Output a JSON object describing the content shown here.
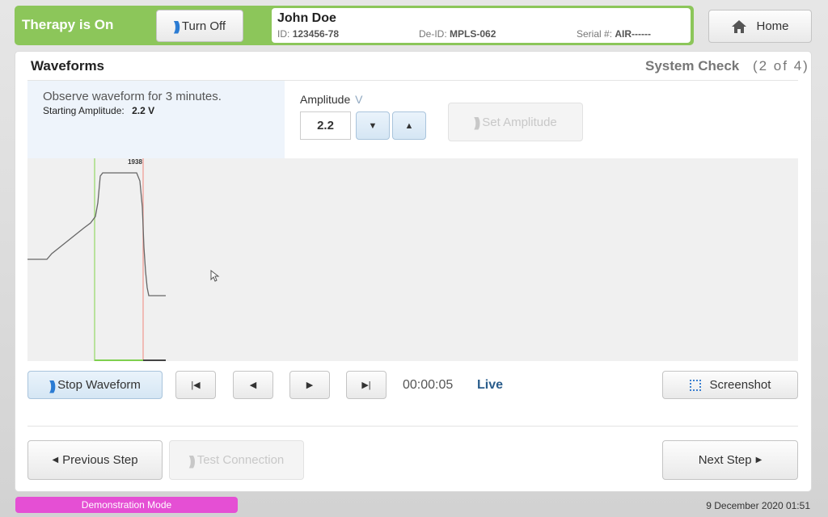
{
  "header": {
    "therapy_status": "Therapy is On",
    "turn_off_label": "Turn Off",
    "home_label": "Home",
    "patient": {
      "name": "John Doe",
      "id_label": "ID:",
      "id_value": "123456-78",
      "deid_label": "De-ID:",
      "deid_value": "MPLS-062",
      "serial_label": "Serial #:",
      "serial_value": "AIR------"
    }
  },
  "panel": {
    "title": "Waveforms",
    "step_label": "System Check",
    "step_progress": "(2 of 4)",
    "instruction": "Observe waveform for 3 minutes.",
    "starting_amp_label": "Starting Amplitude:",
    "starting_amp_value": "2.2 V",
    "amplitude_label": "Amplitude",
    "amplitude_unit": "V",
    "amplitude_value": "2.2",
    "set_amplitude_label": "Set Amplitude"
  },
  "chart": {
    "marker_label": "1938",
    "green_color": "#7fcf4f",
    "red_color": "#e8736b",
    "trace_color": "#666666"
  },
  "playback": {
    "stop_waveform_label": "Stop Waveform",
    "time": "00:00:05",
    "live_label": "Live",
    "screenshot_label": "Screenshot"
  },
  "nav": {
    "previous_label": "Previous Step",
    "test_connection_label": "Test Connection",
    "next_label": "Next Step"
  },
  "footer": {
    "mode": "Demonstration Mode",
    "datetime": "9 December 2020 01:51"
  },
  "colors": {
    "accent_green": "#8cc65a",
    "mode_pink": "#e54fd4",
    "live_blue": "#2a5d8c"
  }
}
